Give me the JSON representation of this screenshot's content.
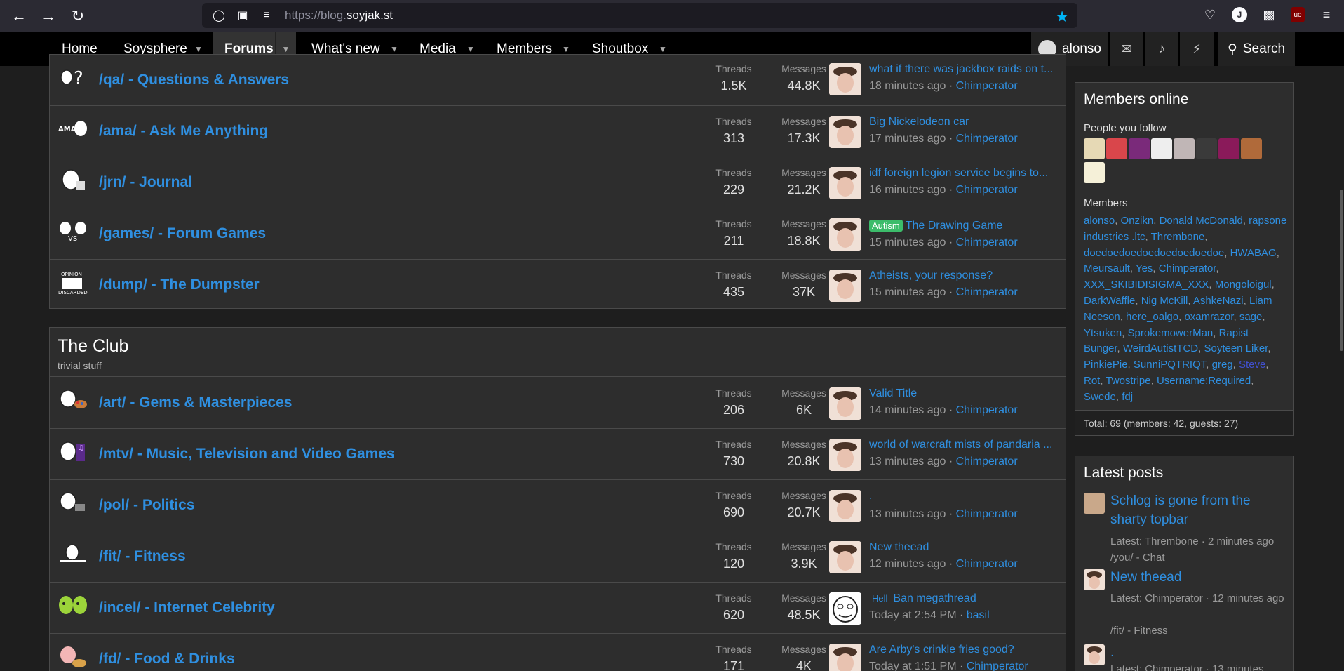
{
  "browser": {
    "url_prefix": "https://blog.",
    "url_domain": "soyjak.st"
  },
  "nav": {
    "home": "Home",
    "soysphere": "Soysphere",
    "forums": "Forums",
    "whats_new": "What's new",
    "media": "Media",
    "members": "Members",
    "shoutbox": "Shoutbox",
    "username": "alonso",
    "search": "Search"
  },
  "labels": {
    "threads": "Threads",
    "messages": "Messages"
  },
  "forums_top": [
    {
      "title": "/qa/ - Questions & Answers",
      "threads": "1.5K",
      "messages": "44.8K",
      "last_title": "what if there was jackbox raids on t...",
      "last_time": "18 minutes ago",
      "last_user": "Chimperator"
    },
    {
      "title": "/ama/ - Ask Me Anything",
      "threads": "313",
      "messages": "17.3K",
      "last_title": "Big Nickelodeon car",
      "last_time": "17 minutes ago",
      "last_user": "Chimperator"
    },
    {
      "title": "/jrn/ - Journal",
      "threads": "229",
      "messages": "21.2K",
      "last_title": "idf foreign legion service begins to...",
      "last_time": "16 minutes ago",
      "last_user": "Chimperator"
    },
    {
      "title": "/games/ - Forum Games",
      "threads": "211",
      "messages": "18.8K",
      "last_prefix": "Autism",
      "last_title": "The Drawing Game",
      "last_time": "15 minutes ago",
      "last_user": "Chimperator"
    },
    {
      "title": "/dump/ - The Dumpster",
      "threads": "435",
      "messages": "37K",
      "last_title": "Atheists, your response?",
      "last_time": "15 minutes ago",
      "last_user": "Chimperator"
    }
  ],
  "category": {
    "title": "The Club",
    "description": "trivial stuff"
  },
  "forums_club": [
    {
      "title": "/art/ - Gems & Masterpieces",
      "threads": "206",
      "messages": "6K",
      "last_title": "Valid Title",
      "last_time": "14 minutes ago",
      "last_user": "Chimperator"
    },
    {
      "title": "/mtv/ - Music, Television and Video Games",
      "threads": "730",
      "messages": "20.8K",
      "last_title": "world of warcraft mists of pandaria ...",
      "last_time": "13 minutes ago",
      "last_user": "Chimperator"
    },
    {
      "title": "/pol/ - Politics",
      "threads": "690",
      "messages": "20.7K",
      "last_title": ".",
      "last_time": "13 minutes ago",
      "last_user": "Chimperator"
    },
    {
      "title": "/fit/ - Fitness",
      "threads": "120",
      "messages": "3.9K",
      "last_title": "New theead",
      "last_time": "12 minutes ago",
      "last_user": "Chimperator"
    },
    {
      "title": "/incel/ - Internet Celebrity",
      "threads": "620",
      "messages": "48.5K",
      "last_prefix": "Hell",
      "last_title": "Ban megathread",
      "last_time": "Today at 2:54 PM",
      "last_user": "basil"
    },
    {
      "title": "/fd/ - Food & Drinks",
      "threads": "171",
      "messages": "4K",
      "last_title": "Are Arby's crinkle fries good?",
      "last_time": "Today at 1:51 PM",
      "last_user": "Chimperator"
    }
  ],
  "members_online": {
    "title": "Members online",
    "follow_label": "People you follow",
    "members_label": "Members",
    "members": [
      "alonso",
      "Onzikn",
      "Donald McDonald",
      "rapsone industries .ltc",
      "Thrembone",
      "doedoedoedoedoedoedoedoe",
      "HWABAG",
      "Meursault",
      "Yes",
      "Chimperator",
      "XXX_SKIBIDISIGMA_XXX",
      "Mongoloigul",
      "DarkWaffle",
      "Nig McKill",
      "AshkeNazi",
      "Liam Neeson",
      "here_oalgo",
      "oxamrazor",
      "sage",
      "Ytsuken",
      "SprokemowerMan",
      "Rapist Bunger",
      "WeirdAutistTCD",
      "Soyteen Liker",
      "PinkiePie",
      "SunniPQTRIQT",
      "greg",
      "Steve",
      "Rot",
      "Twostripe",
      "Username:Required",
      "Swede",
      "fdj"
    ],
    "total": "Total: 69 (members: 42, guests: 27)"
  },
  "latest_posts": {
    "title": "Latest posts",
    "items": [
      {
        "title": "Schlog is gone from the sharty topbar",
        "meta": "Latest: Thrembone · 2 minutes ago",
        "forum": "/you/ - Chat"
      },
      {
        "title": "New theead",
        "meta": "Latest: Chimperator · 12 minutes ago",
        "forum": "/fit/ - Fitness"
      },
      {
        "title": ".",
        "meta": "Latest: Chimperator · 13 minutes",
        "forum": ""
      }
    ]
  },
  "colors": {
    "link": "#2f8fe0",
    "background": "#1e1e1e",
    "block": "#2d2d2d",
    "nav": "#000000",
    "prefix_autism": "#3cbc6a"
  }
}
